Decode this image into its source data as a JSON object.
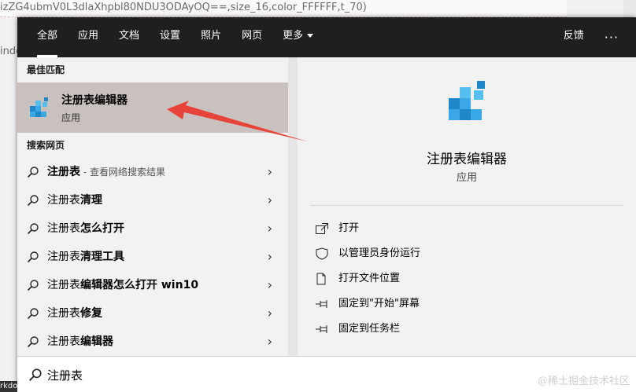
{
  "background": {
    "url_fragment": "izZG4ubmV0L3dlaXhpbl80NDU3ODAyOQ==,size_16,color_FFFFFF,t_70)",
    "left_fragment": "indo",
    "bottom_fragment": "rkdo",
    "watermark": "@稀土掘金技术社区"
  },
  "topbar": {
    "tabs": [
      {
        "label": "全部",
        "active": true
      },
      {
        "label": "应用"
      },
      {
        "label": "文档"
      },
      {
        "label": "设置"
      },
      {
        "label": "照片"
      },
      {
        "label": "网页"
      },
      {
        "label": "更多"
      }
    ],
    "feedback": "反馈",
    "more_options": "···"
  },
  "left": {
    "best_match_title": "最佳匹配",
    "best_match": {
      "name": "注册表编辑器",
      "type": "应用"
    },
    "web_title": "搜索网页",
    "web_items": [
      {
        "bold": "注册表",
        "rest": "",
        "sub": " - 查看网络搜索结果"
      },
      {
        "bold": "",
        "rest": "注册表",
        "bold2": "清理"
      },
      {
        "bold": "",
        "rest": "注册表",
        "bold2": "怎么打开"
      },
      {
        "bold": "",
        "rest": "注册表",
        "bold2": "清理工具"
      },
      {
        "bold": "",
        "rest": "注册表",
        "bold2": "编辑器怎么打开 win10"
      },
      {
        "bold": "",
        "rest": "注册表",
        "bold2": "修复"
      },
      {
        "bold": "",
        "rest": "注册表",
        "bold2": "编辑器"
      }
    ]
  },
  "right": {
    "app_name": "注册表编辑器",
    "app_type": "应用",
    "actions": [
      {
        "label": "打开",
        "icon": "open-icon"
      },
      {
        "label": "以管理员身份运行",
        "icon": "shield-icon"
      },
      {
        "label": "打开文件位置",
        "icon": "file-location-icon"
      },
      {
        "label": "固定到\"开始\"屏幕",
        "icon": "pin-icon"
      },
      {
        "label": "固定到任务栏",
        "icon": "pin-icon"
      }
    ]
  },
  "search": {
    "value": "注册表",
    "icon": "search-icon"
  },
  "colors": {
    "panel_dark": "#1f1f1f",
    "selected": "#c9c1bd",
    "arrow": "#e8433a"
  }
}
